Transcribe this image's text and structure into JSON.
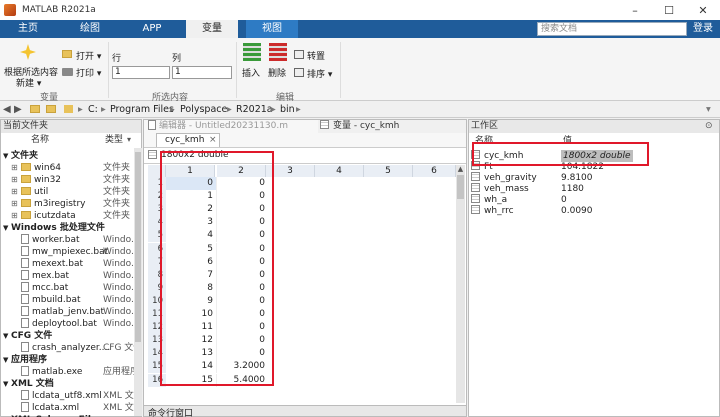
{
  "window": {
    "title": "MATLAB R2021a",
    "minimize": "–",
    "maximize": "☐",
    "close": "✕"
  },
  "tabs": [
    {
      "label": "主页"
    },
    {
      "label": "绘图"
    },
    {
      "label": "APP"
    },
    {
      "label": "变量"
    },
    {
      "label": "视图"
    }
  ],
  "search": {
    "placeholder": "搜索文档"
  },
  "login": "登录",
  "ribbon": {
    "new_from_selection": "根据所选内容",
    "new_from_selection2": "新建 ▾",
    "open": "打开 ▾",
    "print": "打印 ▾",
    "row_label": "行",
    "col_label": "列",
    "row_value": "1",
    "col_value": "1",
    "insert": "插入",
    "delete": "删除",
    "transpose": "转置",
    "sort": "排序 ▾",
    "group_variable": "变量",
    "group_selection": "所选内容",
    "group_edit": "编辑"
  },
  "path": {
    "drive": "C:",
    "parts": [
      "Program Files",
      "Polyspace",
      "R2021a",
      "bin"
    ]
  },
  "current_folder": {
    "title": "当前文件夹",
    "col_name": "名称",
    "col_type": "类型",
    "groups": [
      {
        "header": "文件夹",
        "items": [
          {
            "name": "win64",
            "type": "文件夹"
          },
          {
            "name": "win32",
            "type": "文件夹"
          },
          {
            "name": "util",
            "type": "文件夹"
          },
          {
            "name": "m3iregistry",
            "type": "文件夹"
          },
          {
            "name": "icutzdata",
            "type": "文件夹"
          }
        ]
      },
      {
        "header": "Windows 批处理文件",
        "items": [
          {
            "name": "worker.bat",
            "type": "Windo..."
          },
          {
            "name": "mw_mpiexec.bat",
            "type": "Windo..."
          },
          {
            "name": "mexext.bat",
            "type": "Windo..."
          },
          {
            "name": "mex.bat",
            "type": "Windo..."
          },
          {
            "name": "mcc.bat",
            "type": "Windo..."
          },
          {
            "name": "mbuild.bat",
            "type": "Windo..."
          },
          {
            "name": "matlab_jenv.bat",
            "type": "Windo..."
          },
          {
            "name": "deploytool.bat",
            "type": "Windo..."
          }
        ]
      },
      {
        "header": "CFG 文件",
        "items": [
          {
            "name": "crash_analyzer....",
            "type": "CFG 文件"
          }
        ]
      },
      {
        "header": "应用程序",
        "items": [
          {
            "name": "matlab.exe",
            "type": "应用程序"
          }
        ]
      },
      {
        "header": "XML 文档",
        "items": [
          {
            "name": "lcdata_utf8.xml",
            "type": "XML 文档"
          },
          {
            "name": "lcdata.xml",
            "type": "XML 文档"
          }
        ]
      },
      {
        "header": "XML Schema File",
        "items": []
      }
    ]
  },
  "editor_tab": "编辑器 - Untitled20231130.m",
  "variable_tab": "变量 - cyc_kmh",
  "variable": {
    "tab": "cyc_kmh",
    "close": "×",
    "size": "1800x2 double",
    "columns": [
      "1",
      "2",
      "3",
      "4",
      "5",
      "6"
    ],
    "rows": [
      {
        "n": "1",
        "c1": "0",
        "c2": "0"
      },
      {
        "n": "2",
        "c1": "1",
        "c2": "0"
      },
      {
        "n": "3",
        "c1": "2",
        "c2": "0"
      },
      {
        "n": "4",
        "c1": "3",
        "c2": "0"
      },
      {
        "n": "5",
        "c1": "4",
        "c2": "0"
      },
      {
        "n": "6",
        "c1": "5",
        "c2": "0"
      },
      {
        "n": "7",
        "c1": "6",
        "c2": "0"
      },
      {
        "n": "8",
        "c1": "7",
        "c2": "0"
      },
      {
        "n": "9",
        "c1": "8",
        "c2": "0"
      },
      {
        "n": "10",
        "c1": "9",
        "c2": "0"
      },
      {
        "n": "11",
        "c1": "10",
        "c2": "0"
      },
      {
        "n": "12",
        "c1": "11",
        "c2": "0"
      },
      {
        "n": "13",
        "c1": "12",
        "c2": "0"
      },
      {
        "n": "14",
        "c1": "13",
        "c2": "0"
      },
      {
        "n": "15",
        "c1": "14",
        "c2": "3.2000"
      },
      {
        "n": "16",
        "c1": "15",
        "c2": "5.4000"
      }
    ]
  },
  "command_window": "命令行窗口",
  "workspace": {
    "title": "工作区",
    "col_name": "名称",
    "col_value": "值",
    "items": [
      {
        "name": "cyc_kmh",
        "value": "1800x2 double"
      },
      {
        "name": "Ft",
        "value": "104.1822"
      },
      {
        "name": "veh_gravity",
        "value": "9.8100"
      },
      {
        "name": "veh_mass",
        "value": "1180"
      },
      {
        "name": "wh_a",
        "value": "0"
      },
      {
        "name": "wh_rrc",
        "value": "0.0090"
      }
    ]
  },
  "colors": {
    "tabbar": "#1f5c9a",
    "view_tab": "#2e7bc4",
    "highlight": "#e0182a",
    "folder": "#e8c25a"
  }
}
